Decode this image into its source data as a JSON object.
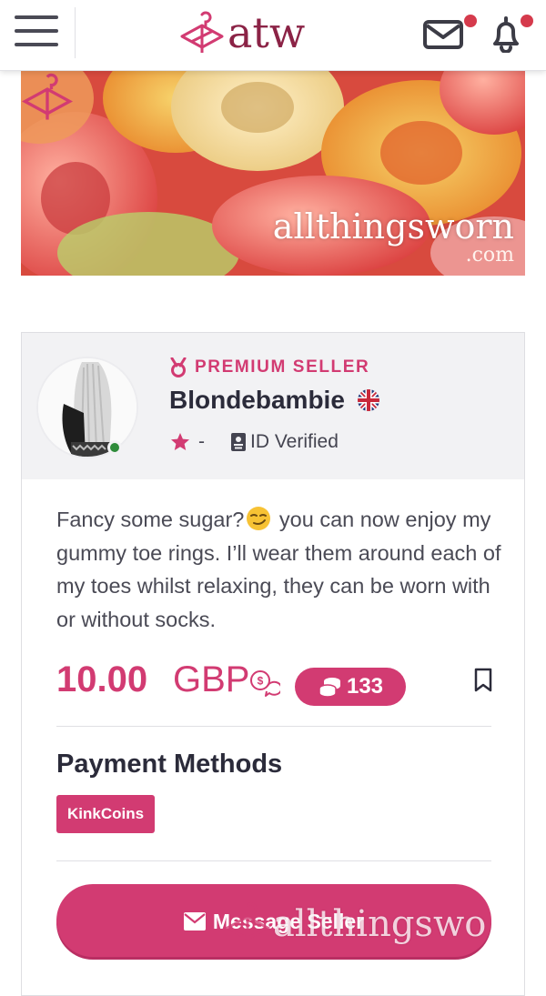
{
  "header": {
    "logo_text": "atw",
    "menu_icon": "hamburger-menu-icon",
    "mail_icon": "envelope-icon",
    "bell_icon": "bell-icon",
    "has_unread_messages": true,
    "has_unread_notifications": true
  },
  "banner": {
    "brand_main": "allthingsworn",
    "brand_sub": ".com"
  },
  "seller": {
    "badge": "PREMIUM SELLER",
    "name": "Blondebambie",
    "country_flag": "uk-flag-icon",
    "rating": "-",
    "verification": "ID Verified",
    "online": true
  },
  "listing": {
    "description_before_emoji": "Fancy some sugar?",
    "emoji": "smirking-face-emoji",
    "description_after_emoji": " you can now enjoy my gummy toe rings. I’ll wear them around each of my toes whilst relaxing, they can be worn with or without socks.",
    "price": "10.00",
    "currency": "GBP",
    "coins": "133"
  },
  "payment": {
    "title": "Payment Methods",
    "methods": [
      "KinkCoins"
    ]
  },
  "actions": {
    "message_label": "Message Seller"
  },
  "watermark": {
    "text": "allthingswo"
  },
  "colors": {
    "accent": "#d23b72",
    "brand": "#8b2346",
    "notification": "#d53a4c",
    "online": "#2e8b3a"
  }
}
